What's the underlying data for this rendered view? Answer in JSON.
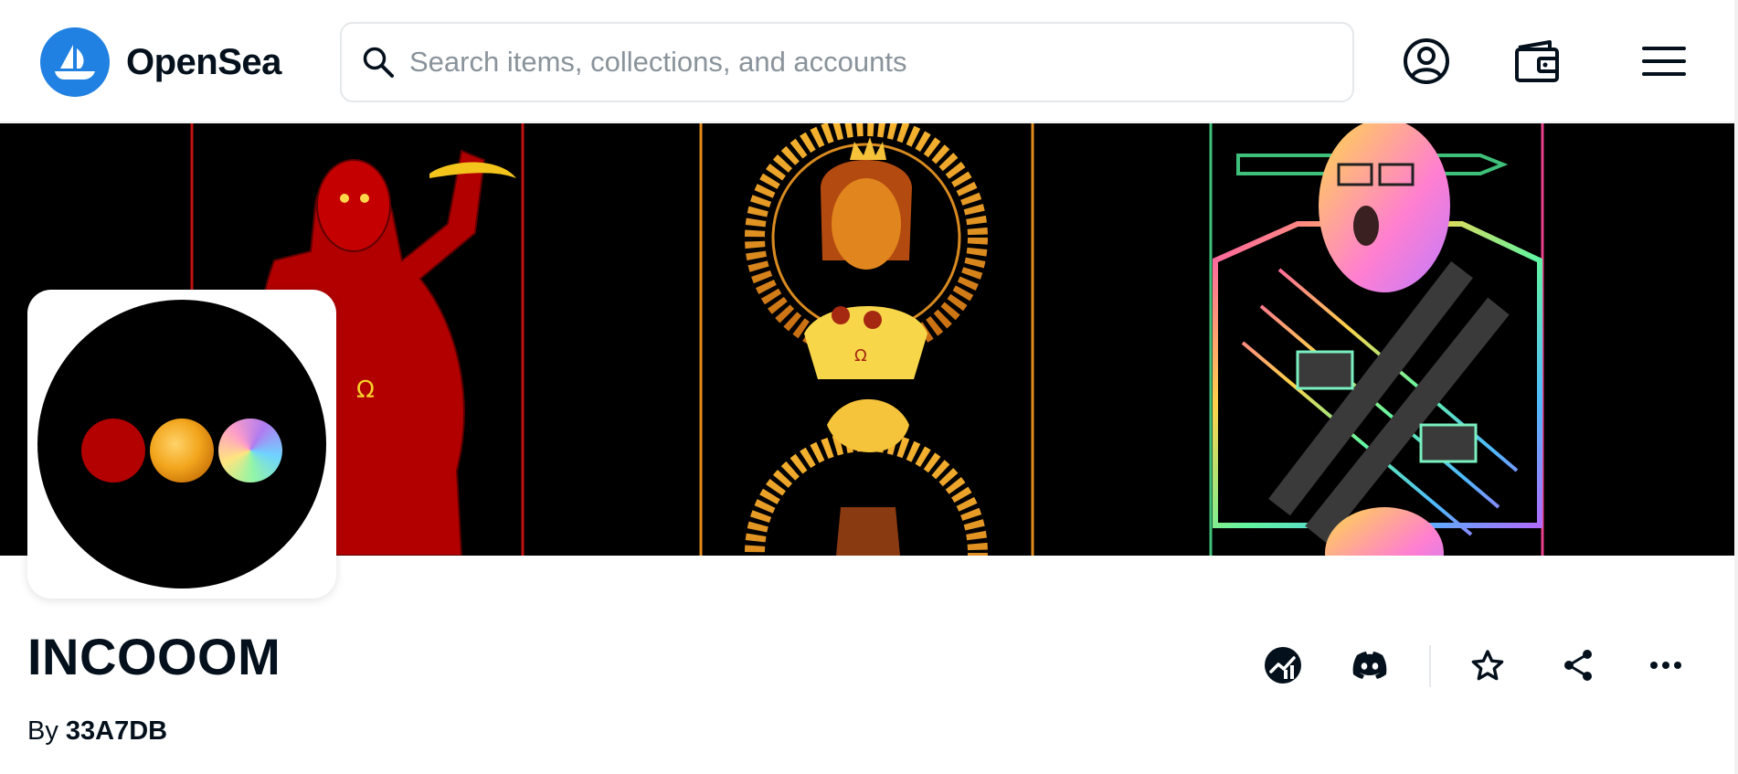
{
  "header": {
    "brand": "OpenSea",
    "search_placeholder": "Search items, collections, and accounts"
  },
  "icons": {
    "logo": "opensea-ship-icon",
    "search": "search-icon",
    "account": "account-icon",
    "wallet": "wallet-icon",
    "menu": "menu-icon",
    "website": "website-chart-icon",
    "discord": "discord-icon",
    "favorite": "star-icon",
    "share": "share-icon",
    "more": "more-icon"
  },
  "collection": {
    "name": "INCOOOM",
    "by_label": "By",
    "creator": "33A7DB",
    "banner_glyph": "Ω"
  },
  "colors": {
    "brand_blue": "#2081e2",
    "text_dark": "#04111d",
    "placeholder": "#8a939b"
  }
}
